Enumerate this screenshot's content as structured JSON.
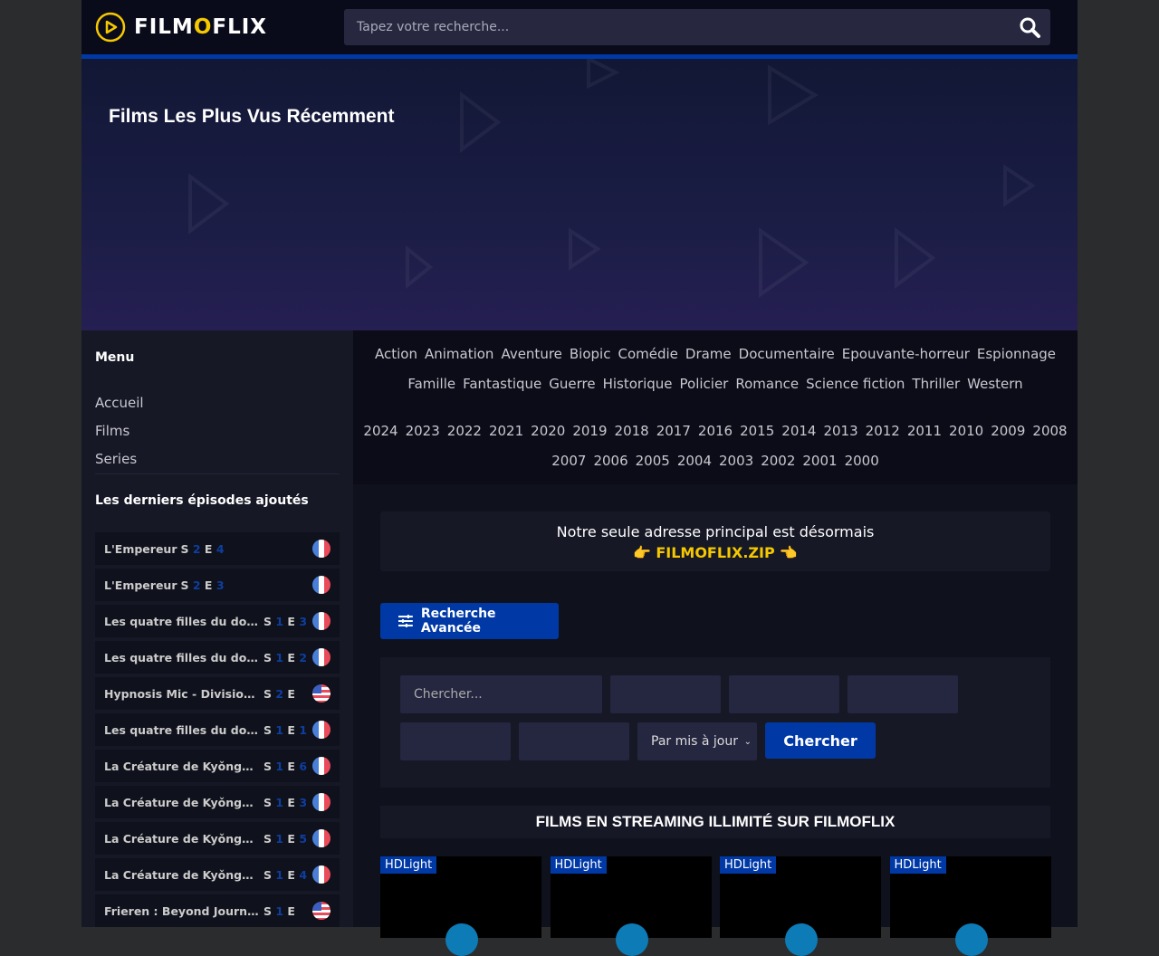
{
  "header": {
    "logo_pre": "FILM",
    "logo_o": "O",
    "logo_post": "FLIX",
    "search_placeholder": "Tapez votre recherche..."
  },
  "hero": {
    "title": "Films Les Plus Vus Récemment"
  },
  "sidebar": {
    "menu_title": "Menu",
    "links": [
      "Accueil",
      "Films",
      "Series"
    ],
    "episodes_title": "Les derniers épisodes ajoutés",
    "episodes": [
      {
        "title": "L'Empereur",
        "s": "2",
        "e": "4",
        "flag": "fr"
      },
      {
        "title": "L'Empereur",
        "s": "2",
        "e": "3",
        "flag": "fr"
      },
      {
        "title": "Les quatre filles du docte...",
        "s": "1",
        "e": "3",
        "flag": "fr"
      },
      {
        "title": "Les quatre filles du docte...",
        "s": "1",
        "e": "2",
        "flag": "fr"
      },
      {
        "title": "Hypnosis Mic - Division Ra...",
        "s": "2",
        "e": "",
        "flag": "us"
      },
      {
        "title": "Les quatre filles du docte...",
        "s": "1",
        "e": "1",
        "flag": "fr"
      },
      {
        "title": "La Créature de Kyǒngsǒng",
        "s": "1",
        "e": "6",
        "flag": "fr"
      },
      {
        "title": "La Créature de Kyǒngsǒng",
        "s": "1",
        "e": "3",
        "flag": "fr"
      },
      {
        "title": "La Créature de Kyǒngsǒng",
        "s": "1",
        "e": "5",
        "flag": "fr"
      },
      {
        "title": "La Créature de Kyǒngsǒng",
        "s": "1",
        "e": "4",
        "flag": "fr"
      },
      {
        "title": "Frieren : Beyond Journey'...",
        "s": "1",
        "e": "",
        "flag": "us"
      }
    ]
  },
  "genres": [
    [
      "Action",
      "Animation",
      "Aventure",
      "Biopic",
      "Comédie",
      "Drame",
      "Documentaire",
      "Epouvante-horreur",
      "Espionnage"
    ],
    [
      "Famille",
      "Fantastique",
      "Guerre",
      "Historique",
      "Policier",
      "Romance",
      "Science fiction",
      "Thriller",
      "Western"
    ]
  ],
  "years": [
    [
      "2024",
      "2023",
      "2022",
      "2021",
      "2020",
      "2019",
      "2018",
      "2017",
      "2016",
      "2015",
      "2014",
      "2013",
      "2012",
      "2011",
      "2010",
      "2009",
      "2008"
    ],
    [
      "2007",
      "2006",
      "2005",
      "2004",
      "2003",
      "2002",
      "2001",
      "2000"
    ]
  ],
  "notice": {
    "line1": "Notre seule adresse principal est désormais",
    "link": "FILMOFLIX.ZIP"
  },
  "advanced": {
    "label": "Recherche Avancée"
  },
  "form": {
    "search_placeholder": "Chercher...",
    "sort_value": "Par mis à jour",
    "submit": "Chercher"
  },
  "section_title": "FILMS EN STREAMING ILLIMITÉ SUR FILMOFLIX",
  "cards": [
    {
      "quality": "HDLight"
    },
    {
      "quality": "HDLight"
    },
    {
      "quality": "HDLight"
    },
    {
      "quality": "HDLight"
    }
  ],
  "colors": {
    "accent": "#0039a6",
    "logo": "#f5c800"
  }
}
